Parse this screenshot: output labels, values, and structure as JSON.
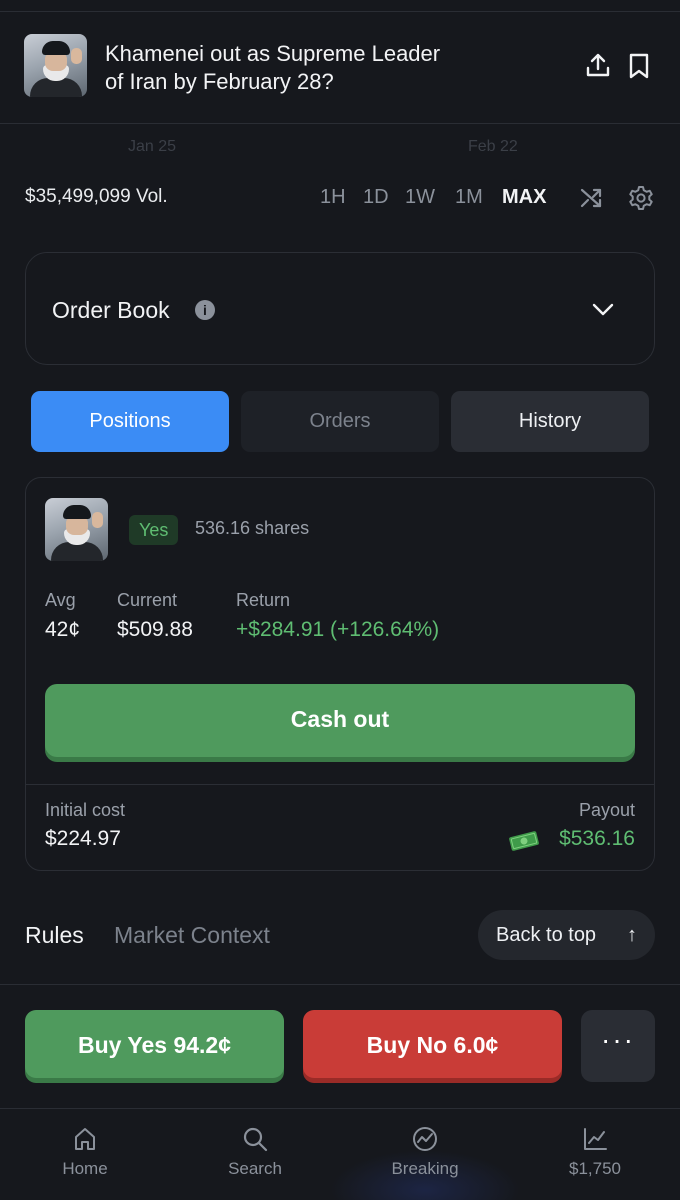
{
  "header": {
    "title": "Khamenei out as Supreme Leader of Iran by February 28?"
  },
  "chart": {
    "axis_labels": [
      "Jan 25",
      "Feb 22"
    ]
  },
  "stats": {
    "volume": "$35,499,099 Vol."
  },
  "ranges": [
    "1H",
    "1D",
    "1W",
    "1M",
    "MAX"
  ],
  "active_range": "MAX",
  "order_book": {
    "label": "Order Book"
  },
  "tabs": {
    "positions": "Positions",
    "orders": "Orders",
    "history": "History"
  },
  "position": {
    "outcome": "Yes",
    "shares": "536.16 shares",
    "avg_label": "Avg",
    "avg_value": "42¢",
    "current_label": "Current",
    "current_value": "$509.88",
    "return_label": "Return",
    "return_value": "+$284.91 (+126.64%)",
    "cash_out_label": "Cash out",
    "initial_cost_label": "Initial cost",
    "initial_cost_value": "$224.97",
    "payout_label": "Payout",
    "payout_value": "$536.16"
  },
  "rules_tabs": {
    "rules": "Rules",
    "market_context": "Market Context"
  },
  "back_to_top": "Back to top",
  "actions": {
    "buy_yes": "Buy Yes 94.2¢",
    "buy_no": "Buy No 6.0¢",
    "more": "···"
  },
  "nav": {
    "home": "Home",
    "search": "Search",
    "breaking": "Breaking",
    "portfolio": "$1,750"
  },
  "colors": {
    "background": "#16181d",
    "accent_blue": "#3b8cf5",
    "yes_green": "#4f9a5d",
    "no_red": "#c93c37",
    "gain_green": "#5fbd72"
  }
}
